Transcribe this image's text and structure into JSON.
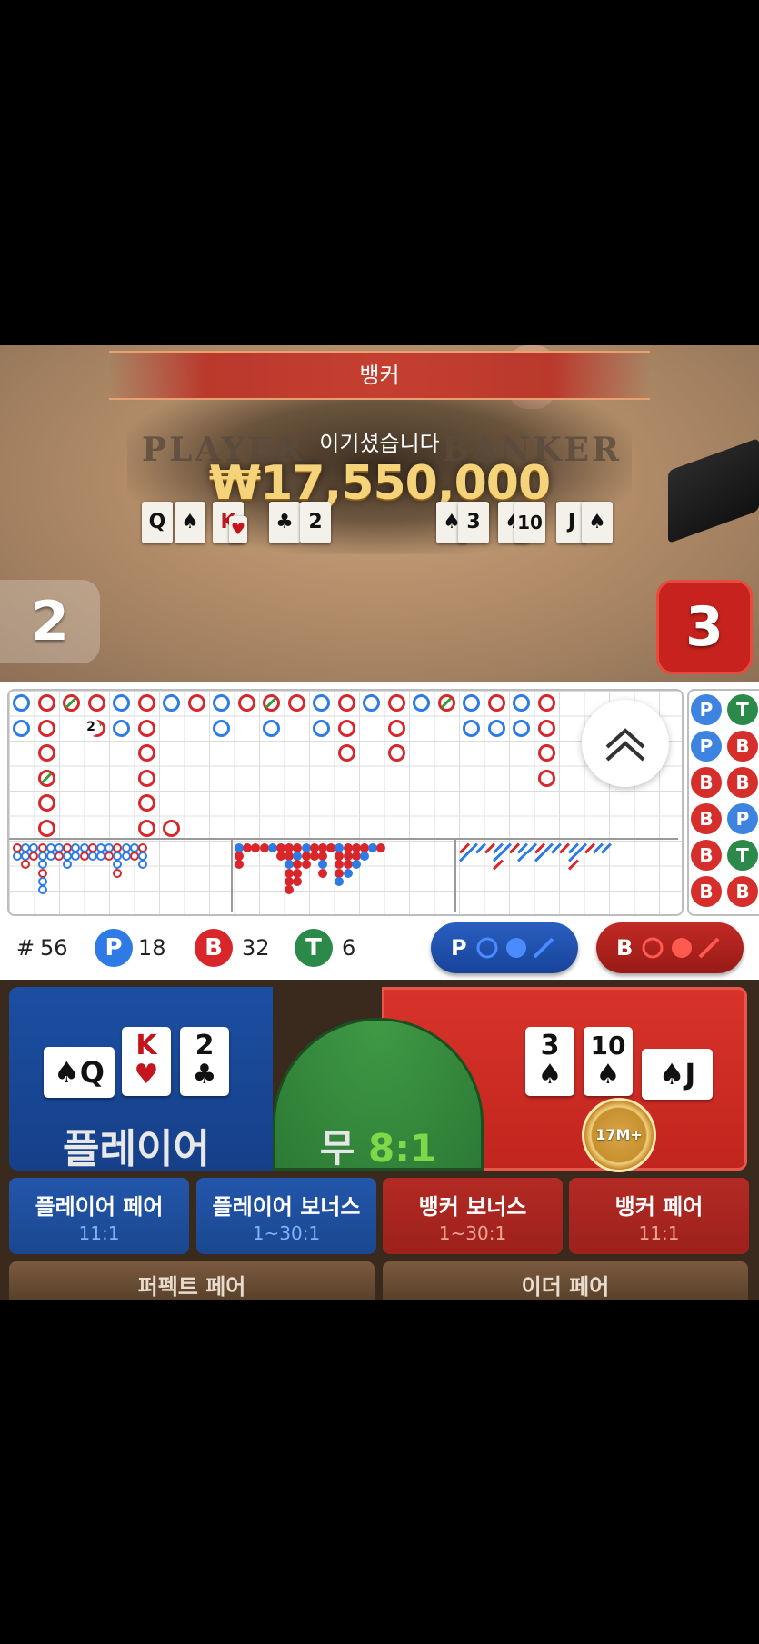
{
  "result": {
    "banner": "뱅커",
    "win_title": "이기셨습니다",
    "win_amount": "₩17,550,000",
    "table_player_word": "PLAYER",
    "table_banker_word": "BANKER",
    "player_score": "2",
    "banker_score": "3",
    "table_player_cards": [
      {
        "rank": "Q",
        "suit": "♠",
        "red": false
      },
      {
        "rank": "K",
        "suit": "♥",
        "red": true
      },
      {
        "rank": "2",
        "suit": "♣",
        "red": false
      }
    ],
    "table_banker_cards": [
      {
        "rank": "3",
        "suit": "♠",
        "red": false
      },
      {
        "rank": "10",
        "suit": "♠",
        "red": false
      },
      {
        "rank": "J",
        "suit": "♠",
        "red": false
      }
    ]
  },
  "roadmap": {
    "bead_tie_count_label": "2",
    "collapse_icon": "double-chevron-up-icon",
    "side_chips": [
      [
        "P",
        "T"
      ],
      [
        "P",
        "B"
      ],
      [
        "B",
        "B"
      ],
      [
        "B",
        "P"
      ],
      [
        "B",
        "T"
      ],
      [
        "B",
        "B"
      ]
    ]
  },
  "stats": {
    "hash": "#",
    "rounds": "56",
    "player_letter": "P",
    "player_count": "18",
    "banker_letter": "B",
    "banker_count": "32",
    "tie_letter": "T",
    "tie_count": "6",
    "player_predict_letter": "P",
    "banker_predict_letter": "B",
    "colors": {
      "player": "#2f7be6",
      "banker": "#d9262b",
      "tie": "#2b8a4a"
    }
  },
  "betting": {
    "player_label": "플레이어",
    "tie_label": "무",
    "tie_odds": "8:1",
    "chip_label": "17M+",
    "player_cards": [
      {
        "rank": "Q",
        "suit": "♠",
        "red": false
      },
      {
        "rank": "K",
        "suit": "♥",
        "red": true
      },
      {
        "rank": "2",
        "suit": "♣",
        "red": false
      }
    ],
    "banker_cards": [
      {
        "rank": "3",
        "suit": "♠",
        "red": false
      },
      {
        "rank": "10",
        "suit": "♠",
        "red": false
      },
      {
        "rank": "J",
        "suit": "♠",
        "red": false
      }
    ],
    "side_bets": [
      {
        "name": "플레이어 페어",
        "odds": "11:1"
      },
      {
        "name": "플레이어 보너스",
        "odds": "1~30:1"
      },
      {
        "name": "뱅커 보너스",
        "odds": "1~30:1"
      },
      {
        "name": "뱅커 페어",
        "odds": "11:1"
      }
    ],
    "perfect_pair": "퍼펙트 페어",
    "either_pair": "이더 페어"
  }
}
